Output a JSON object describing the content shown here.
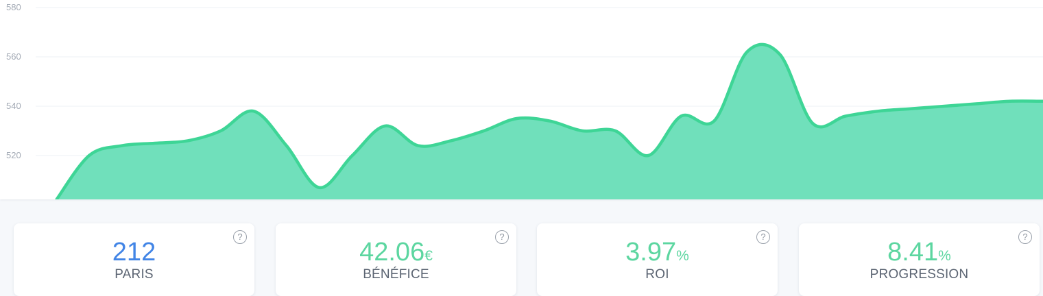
{
  "chart_data": {
    "type": "area",
    "title": "",
    "xlabel": "",
    "ylabel": "",
    "ylim": [
      502,
      580
    ],
    "yticks": [
      520,
      540,
      560,
      580
    ],
    "grid": true,
    "color": "#3ed596",
    "fill_color": "#70e0bb",
    "x": [
      0,
      1,
      2,
      3,
      4,
      5,
      6,
      7,
      8,
      9,
      10,
      11,
      12,
      13,
      14,
      15,
      16,
      17,
      18,
      19,
      20,
      21,
      22,
      23,
      24,
      25,
      26,
      27,
      28,
      29,
      30
    ],
    "values": [
      502,
      520,
      524,
      525,
      526,
      530,
      538,
      524,
      507,
      520,
      532,
      524,
      526,
      530,
      535,
      534,
      530,
      530,
      520,
      536,
      534,
      562,
      561,
      533,
      536,
      538,
      539,
      540,
      541,
      542,
      542
    ]
  },
  "cards": [
    {
      "value": "212",
      "unit": "",
      "label": "PARIS",
      "color": "#4285e6",
      "help": "?"
    },
    {
      "value": "42.06",
      "unit": "€",
      "label": "BÉNÉFICE",
      "color": "#5cd6a0",
      "help": "?"
    },
    {
      "value": "3.97",
      "unit": "%",
      "label": "ROI",
      "color": "#5cd6a0",
      "help": "?"
    },
    {
      "value": "8.41",
      "unit": "%",
      "label": "PROGRESSION",
      "color": "#5cd6a0",
      "help": "?"
    }
  ]
}
